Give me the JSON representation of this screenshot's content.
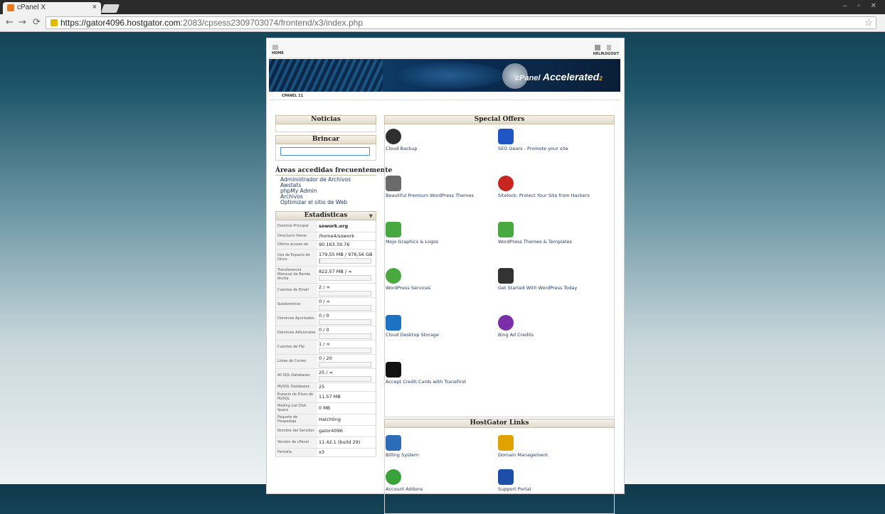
{
  "browser": {
    "tab_title": "cPanel X",
    "tab_close": "×",
    "url_host": "https://gator4096.hostgator.com",
    "url_rest": ":2083/cpsess2309703074/frontend/x3/index.php",
    "window_controls": "– ▫ ✕"
  },
  "topnav": {
    "home": "HOME",
    "help": "HELP",
    "logout": "LOGOUT"
  },
  "banner": {
    "brand": "cPanel",
    "accelerated": "Accelerated",
    "sub": "2"
  },
  "version_label": "CPANEL 11",
  "left": {
    "noticias_title": "Noticias",
    "brincar_title": "Brincar",
    "search_value": "",
    "freq_title": "Áreas accedidas frecuentemente",
    "freq_links": [
      "Administrador de Archivos",
      "Awstats",
      "phpMy Admin",
      "Archivos",
      "Optimizar el sitio de Web"
    ],
    "stats_title": "Estadísticas",
    "stats": [
      {
        "label": "Dominio Principal",
        "value": "sowork.org",
        "bold": true
      },
      {
        "label": "Directorio Home",
        "value": "/home4/sowork"
      },
      {
        "label": "Último acceso de",
        "value": "90.163.39.76"
      },
      {
        "label": "Uso de Espacio de Disco",
        "value": "179,55 MB / 976,56 GB",
        "bar": 0.01
      },
      {
        "label": "Transferencia Mensual de Banda Ancha",
        "value": "822,57 MB / ∞",
        "bar": 0.0
      },
      {
        "label": "Cuentas de Email",
        "value": "2 / ∞",
        "bar": 0.0
      },
      {
        "label": "Subdominios",
        "value": "0 / ∞",
        "bar": 0.0
      },
      {
        "label": "Dominios Apuntados",
        "value": "0 / 0",
        "bar": 0.0
      },
      {
        "label": "Dominios Adicionales",
        "value": "0 / 0",
        "bar": 0.0
      },
      {
        "label": "Cuentas de Ftp",
        "value": "1 / ∞",
        "bar": 0.0
      },
      {
        "label": "Listas de Correo",
        "value": "0 / 20",
        "bar": 0.0
      },
      {
        "label": "All SQL Databases",
        "value": "25 / ∞",
        "bar": 0.0
      },
      {
        "label": "MySQL Databases",
        "value": "25"
      },
      {
        "label": "Espacio de Disco de MySQL",
        "value": "11,57 MB"
      },
      {
        "label": "Mailing List Disk Space",
        "value": "0 MB"
      },
      {
        "label": "Paquete de Hospedaje",
        "value": "Hatchling"
      },
      {
        "label": "Nombre del Servidor",
        "value": "gator4096"
      },
      {
        "label": "Versión de cPanel",
        "value": "11.42.1 (build 29)"
      },
      {
        "label": "Pantalla",
        "value": "x3"
      }
    ]
  },
  "right": {
    "offers_title": "Special Offers",
    "offers": [
      {
        "label": "Cloud Backup",
        "icon": "shield-icon",
        "color": "#2f2f2f"
      },
      {
        "label": "SEO Gears - Promote your site",
        "icon": "seo-icon",
        "color": "#1f56c4"
      },
      {
        "label": "Beautiful Premium WordPress Themes",
        "icon": "themes-icon",
        "color": "#6a6a6a"
      },
      {
        "label": "Sitelock: Protect Your Site from Hackers",
        "icon": "sitelock-icon",
        "color": "#c7261e"
      },
      {
        "label": "Mojo Graphics & Logos",
        "icon": "mojo-icon",
        "color": "#49a840"
      },
      {
        "label": "WordPress Themes & Templates",
        "icon": "templates-icon",
        "color": "#49a840"
      },
      {
        "label": "WordPress Services",
        "icon": "services-icon",
        "color": "#49a840"
      },
      {
        "label": "Get Started With WordPress Today",
        "icon": "wordpress-icon",
        "color": "#333333"
      },
      {
        "label": "Cloud Desktop Storage",
        "icon": "cloud-icon",
        "color": "#1d72c4"
      },
      {
        "label": "Bing Ad Credits",
        "icon": "bing-icon",
        "color": "#7a2ea8"
      },
      {
        "label": "Accept Credit Cards with TransFirst",
        "icon": "transfirst-icon",
        "color": "#111111"
      }
    ],
    "hg_title": "HostGator Links",
    "hg_links": [
      {
        "label": "Billing System",
        "icon": "credit-card-icon",
        "color": "#2d6db7"
      },
      {
        "label": "Domain Management",
        "icon": "dotcom-icon",
        "color": "#e0a200"
      },
      {
        "label": "Account Addons",
        "icon": "plus-icon",
        "color": "#3aa23a"
      },
      {
        "label": "Support Portal",
        "icon": "book-icon",
        "color": "#1d4fa8"
      }
    ]
  }
}
